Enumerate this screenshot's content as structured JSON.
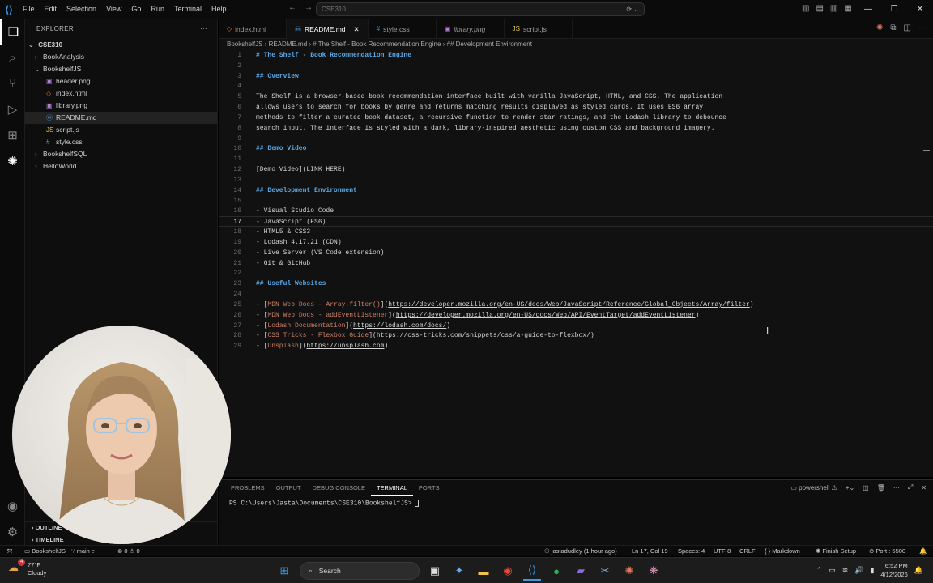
{
  "titlebar": {
    "menu": [
      "File",
      "Edit",
      "Selection",
      "View",
      "Go",
      "Run",
      "Terminal",
      "Help"
    ],
    "search_text": "CSE310"
  },
  "explorer": {
    "title": "EXPLORER",
    "root": "CSE310",
    "items": [
      {
        "label": "BookAnalysis",
        "kind": "folder",
        "expanded": false,
        "depth": 1
      },
      {
        "label": "BookshelfJS",
        "kind": "folder",
        "expanded": true,
        "depth": 1
      },
      {
        "label": "header.png",
        "kind": "png",
        "depth": 2
      },
      {
        "label": "index.html",
        "kind": "html",
        "depth": 2
      },
      {
        "label": "library.png",
        "kind": "png",
        "depth": 2
      },
      {
        "label": "README.md",
        "kind": "md",
        "depth": 2,
        "selected": true
      },
      {
        "label": "script.js",
        "kind": "js",
        "depth": 2
      },
      {
        "label": "style.css",
        "kind": "css",
        "depth": 2
      },
      {
        "label": "BookshelfSQL",
        "kind": "folder",
        "expanded": false,
        "depth": 1
      },
      {
        "label": "HelloWorld",
        "kind": "folder",
        "expanded": false,
        "depth": 1
      }
    ],
    "outline": "OUTLINE",
    "timeline": "TIMELINE"
  },
  "tabs": [
    {
      "label": "index.html",
      "icon": "html",
      "active": false
    },
    {
      "label": "README.md",
      "icon": "md",
      "active": true
    },
    {
      "label": "style.css",
      "icon": "css",
      "active": false
    },
    {
      "label": "library.png",
      "icon": "png",
      "active": false
    },
    {
      "label": "script.js",
      "icon": "js",
      "active": false
    }
  ],
  "breadcrumb": "BookshelfJS  ›  README.md  ›  # The Shelf - Book Recommendation Engine  ›  ## Development Environment",
  "editor": {
    "current_line": 17,
    "lines": [
      {
        "n": "1",
        "type": "heading",
        "text": "# The Shelf - Book Recommendation Engine"
      },
      {
        "n": "2",
        "type": "plain",
        "text": ""
      },
      {
        "n": "3",
        "type": "heading",
        "text": "## Overview"
      },
      {
        "n": "4",
        "type": "plain",
        "text": ""
      },
      {
        "n": "5",
        "type": "plain",
        "text": "The Shelf is a browser-based book recommendation interface built with vanilla JavaScript, HTML, and CSS. The application"
      },
      {
        "n": "6",
        "type": "plain",
        "text": "allows users to search for books by genre and returns matching results displayed as styled cards. It uses ES6 array"
      },
      {
        "n": "7",
        "type": "plain",
        "text": "methods to filter a curated book dataset, a recursive function to render star ratings, and the Lodash library to debounce"
      },
      {
        "n": "8",
        "type": "plain",
        "text": "search input. The interface is styled with a dark, library-inspired aesthetic using custom CSS and background imagery."
      },
      {
        "n": "9",
        "type": "plain",
        "text": ""
      },
      {
        "n": "10",
        "type": "heading",
        "text": "## Demo Video"
      },
      {
        "n": "11",
        "type": "plain",
        "text": ""
      },
      {
        "n": "12",
        "type": "plain",
        "text": "[Demo Video](LINK HERE)"
      },
      {
        "n": "13",
        "type": "plain",
        "text": ""
      },
      {
        "n": "14",
        "type": "heading",
        "text": "## Development Environment"
      },
      {
        "n": "15",
        "type": "plain",
        "text": ""
      },
      {
        "n": "16",
        "type": "plain",
        "text": "- Visual Studio Code"
      },
      {
        "n": "17",
        "type": "plain",
        "text": "- JavaScript (ES6)"
      },
      {
        "n": "18",
        "type": "plain",
        "text": "- HTML5 & CSS3"
      },
      {
        "n": "19",
        "type": "plain",
        "text": "- Lodash 4.17.21 (CDN)"
      },
      {
        "n": "20",
        "type": "plain",
        "text": "- Live Server (VS Code extension)"
      },
      {
        "n": "21",
        "type": "plain",
        "text": "- Git & GitHub"
      },
      {
        "n": "22",
        "type": "plain",
        "text": ""
      },
      {
        "n": "23",
        "type": "heading",
        "text": "## Useful Websites"
      },
      {
        "n": "24",
        "type": "plain",
        "text": ""
      },
      {
        "n": "25",
        "type": "link",
        "prefix": "- [",
        "link": "MDN Web Docs - Array.filter()",
        "mid": "](",
        "url": "https://developer.mozilla.org/en-US/docs/Web/JavaScript/Reference/Global_Objects/Array/filter",
        "suffix": ")"
      },
      {
        "n": "26",
        "type": "link",
        "prefix": "- [",
        "link": "MDN Web Docs - addEventListener",
        "mid": "](",
        "url": "https://developer.mozilla.org/en-US/docs/Web/API/EventTarget/addEventListener",
        "suffix": ")"
      },
      {
        "n": "27",
        "type": "link",
        "prefix": "- [",
        "link": "Lodash Documentation",
        "mid": "](",
        "url": "https://lodash.com/docs/",
        "suffix": ")"
      },
      {
        "n": "28",
        "type": "link",
        "prefix": "- [",
        "link": "CSS Tricks - Flexbox Guide",
        "mid": "](",
        "url": "https://css-tricks.com/snippets/css/a-guide-to-flexbox/",
        "suffix": ")"
      },
      {
        "n": "29",
        "type": "link",
        "prefix": "- [",
        "link": "Unsplash",
        "mid": "](",
        "url": "https://unsplash.com",
        "suffix": ")"
      }
    ]
  },
  "panel": {
    "tabs": [
      "PROBLEMS",
      "OUTPUT",
      "DEBUG CONSOLE",
      "TERMINAL",
      "PORTS"
    ],
    "active_tab": "TERMINAL",
    "shell": "powershell",
    "prompt": "PS C:\\Users\\Jasta\\Documents\\CSE310\\BookshelfJS>"
  },
  "statusbar": {
    "folder": "BookshelfJS",
    "branch": "main",
    "errors": "0",
    "warnings": "0",
    "blame": "jastadudley (1 hour ago)",
    "position": "Ln 17, Col 19",
    "spaces": "Spaces: 4",
    "encoding": "UTF-8",
    "eol": "CRLF",
    "language": "Markdown",
    "finish_setup": "Finish Setup",
    "port": "Port : 5500"
  },
  "taskbar": {
    "temperature": "77°F",
    "weather": "Cloudy",
    "search": "Search",
    "time": "6:52 PM",
    "date": "4/12/2026",
    "notification_count": "4"
  },
  "colors": {
    "heading": "#5aa9e6",
    "link_text": "#ce7e66",
    "accent": "#3b9ae8"
  }
}
